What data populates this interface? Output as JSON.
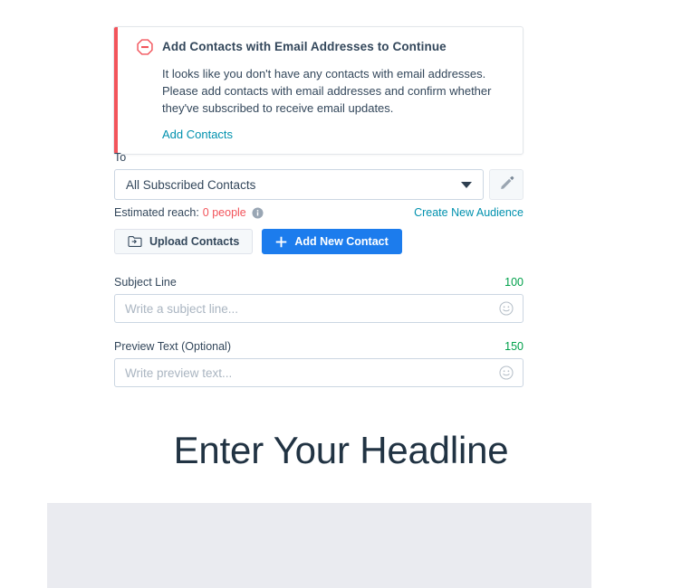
{
  "alert": {
    "icon": "block-octagon-icon",
    "title": "Add Contacts with Email Addresses to Continue",
    "body": "It looks like you don't have any contacts with email addresses. Please add contacts with email addresses and confirm whether they've subscribed to receive email updates.",
    "link_label": "Add Contacts",
    "accent_color": "#f2545b",
    "link_color": "#0091ae"
  },
  "recipients": {
    "to_label": "To",
    "audience_value": "All Subscribed Contacts",
    "caret_icon": "chevron-down-icon",
    "edit_icon": "pencil-icon",
    "reach_label": "Estimated reach:",
    "reach_value": "0 people",
    "reach_value_color": "#f2545b",
    "info_icon": "info-circle-icon",
    "create_audience_label": "Create New Audience",
    "upload_button_label": "Upload Contacts",
    "upload_icon": "folder-upload-icon",
    "add_button_label": "Add New Contact",
    "add_icon": "plus-icon",
    "add_button_color": "#1c7ced"
  },
  "subject": {
    "label": "Subject Line",
    "counter": "100",
    "counter_color": "#00a04a",
    "placeholder": "Write a subject line...",
    "value": "",
    "emoji_icon": "smiley-face-icon"
  },
  "preview": {
    "label": "Preview Text (Optional)",
    "counter": "150",
    "counter_color": "#00a04a",
    "placeholder": "Write preview text...",
    "value": "",
    "emoji_icon": "smiley-face-icon"
  },
  "email_preview": {
    "headline": "Enter Your Headline",
    "headline_color": "#213343",
    "image_placeholder_color": "#eaebf0"
  }
}
